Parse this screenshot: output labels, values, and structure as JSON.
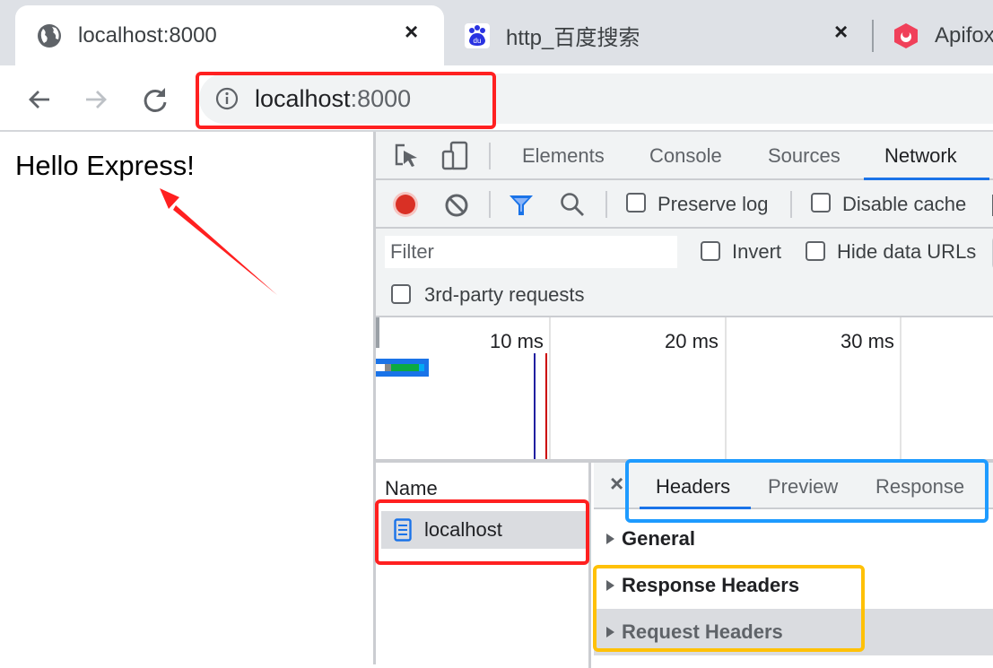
{
  "browser": {
    "tabs": [
      {
        "title": "localhost:8000",
        "favicon": "globe-icon",
        "active": true
      },
      {
        "title": "http_百度搜索",
        "favicon": "baidu-paw-icon",
        "active": false
      },
      {
        "title": "Apifox",
        "favicon": "apifox-icon",
        "active": false
      }
    ],
    "close_glyph": "×",
    "address": {
      "host": "localhost",
      "port": ":8000"
    }
  },
  "page": {
    "content": "Hello Express!"
  },
  "devtools": {
    "tabs": [
      "Elements",
      "Console",
      "Sources",
      "Network"
    ],
    "active_tab": "Network",
    "network_toolbar": {
      "preserve_log": "Preserve log",
      "disable_cache": "Disable cache"
    },
    "filter": {
      "placeholder": "Filter",
      "invert": "Invert",
      "hide_data_urls": "Hide data URLs",
      "third_party": "3rd-party requests"
    },
    "timeline": {
      "ticks": [
        "10 ms",
        "20 ms",
        "30 ms"
      ]
    },
    "requests": {
      "header": "Name",
      "items": [
        {
          "name": "localhost",
          "selected": true
        }
      ]
    },
    "detail": {
      "close_glyph": "×",
      "tabs": [
        "Headers",
        "Preview",
        "Response"
      ],
      "active_tab": "Headers",
      "sections": [
        "General",
        "Response Headers",
        "Request Headers"
      ]
    }
  },
  "colors": {
    "accent": "#1a73e8",
    "record": "#d93025",
    "annotation_red": "#ff2020",
    "annotation_blue": "#1e9bff",
    "annotation_yellow": "#ffc107"
  }
}
